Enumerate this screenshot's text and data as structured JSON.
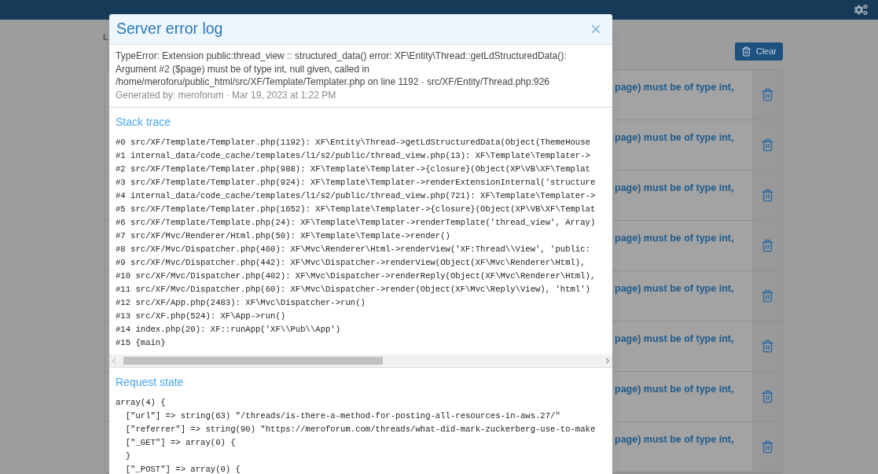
{
  "page": {
    "breadcrumb": "L",
    "clear_button": "Clear"
  },
  "log_rows": [
    {
      "message": "page) must be of type int,"
    },
    {
      "message": "page) must be of type int,"
    },
    {
      "message": "page) must be of type int,"
    },
    {
      "message": "page) must be of type int,"
    },
    {
      "message": "page) must be of type int,"
    },
    {
      "message": "page) must be of type int,"
    },
    {
      "message": "page) must be of type int,"
    },
    {
      "message": "page) must be of type int,"
    }
  ],
  "dialog": {
    "title": "Server error log",
    "close": "×",
    "message": "TypeError: Extension public:thread_view :: structured_data() error: XF\\Entity\\Thread::getLdStructuredData(): Argument #2 ($page) must be of type int, null given, called in /home/meroforu/public_html/src/XF/Template/Templater.php on line 1192 · src/XF/Entity/Thread.php:926",
    "generated": "Generated by: meroforum · Mar 19, 2023 at 1:22 PM",
    "sections": [
      {
        "kind": "trace",
        "heading": "Stack trace",
        "lines": [
          "#0 src/XF/Template/Templater.php(1192): XF\\Entity\\Thread->getLdStructuredData(Object(ThemeHouse",
          "#1 internal_data/code_cache/templates/l1/s2/public/thread_view.php(13): XF\\Template\\Templater->",
          "#2 src/XF/Template/Templater.php(988): XF\\Template\\Templater->{closure}(Object(XP\\VB\\XF\\Templat",
          "#3 src/XF/Template/Templater.php(924): XF\\Template\\Templater->renderExtensionInternal('structure",
          "#4 internal_data/code_cache/templates/l1/s2/public/thread_view.php(721): XF\\Template\\Templater->",
          "#5 src/XF/Template/Templater.php(1652): XF\\Template\\Templater->{closure}(Object(XP\\VB\\XF\\Templat",
          "#6 src/XF/Template/Template.php(24): XF\\Template\\Templater->renderTemplate('thread_view', Array)",
          "#7 src/XF/Mvc/Renderer/Html.php(50): XF\\Template\\Template->render()",
          "#8 src/XF/Mvc/Dispatcher.php(460): XF\\Mvc\\Renderer\\Html->renderView('XF:Thread\\\\View', 'public:",
          "#9 src/XF/Mvc/Dispatcher.php(442): XF\\Mvc\\Dispatcher->renderView(Object(XF\\Mvc\\Renderer\\Html),",
          "#10 src/XF/Mvc/Dispatcher.php(402): XF\\Mvc\\Dispatcher->renderReply(Object(XF\\Mvc\\Renderer\\Html),",
          "#11 src/XF/Mvc/Dispatcher.php(60): XF\\Mvc\\Dispatcher->render(Object(XF\\Mvc\\Reply\\View), 'html')",
          "#12 src/XF/App.php(2483): XF\\Mvc\\Dispatcher->run()",
          "#13 src/XF.php(524): XF\\App->run()",
          "#14 index.php(20): XF::runApp('XF\\\\Pub\\\\App')",
          "#15 {main}"
        ]
      },
      {
        "kind": "dump",
        "heading": "Request state",
        "lines": [
          "array(4) {",
          "  [\"url\"] => string(63) \"/threads/is-there-a-method-for-posting-all-resources-in-aws.27/\"",
          "  [\"referrer\"] => string(90) \"https://meroforum.com/threads/what-did-mark-zuckerberg-use-to-make",
          "  [\"_GET\"] => array(0) {",
          "  }",
          "  [\"_POST\"] => array(0) {"
        ]
      }
    ]
  }
}
